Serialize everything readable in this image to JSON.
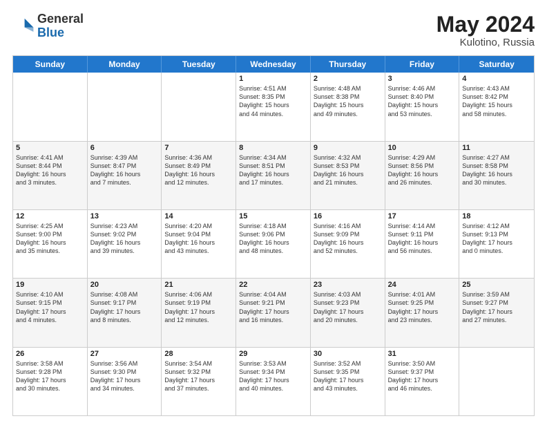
{
  "header": {
    "logo_general": "General",
    "logo_blue": "Blue",
    "month_year": "May 2024",
    "location": "Kulotino, Russia"
  },
  "days_of_week": [
    "Sunday",
    "Monday",
    "Tuesday",
    "Wednesday",
    "Thursday",
    "Friday",
    "Saturday"
  ],
  "rows": [
    {
      "alt": false,
      "cells": [
        {
          "day": "",
          "text": ""
        },
        {
          "day": "",
          "text": ""
        },
        {
          "day": "",
          "text": ""
        },
        {
          "day": "1",
          "text": "Sunrise: 4:51 AM\nSunset: 8:35 PM\nDaylight: 15 hours\nand 44 minutes."
        },
        {
          "day": "2",
          "text": "Sunrise: 4:48 AM\nSunset: 8:38 PM\nDaylight: 15 hours\nand 49 minutes."
        },
        {
          "day": "3",
          "text": "Sunrise: 4:46 AM\nSunset: 8:40 PM\nDaylight: 15 hours\nand 53 minutes."
        },
        {
          "day": "4",
          "text": "Sunrise: 4:43 AM\nSunset: 8:42 PM\nDaylight: 15 hours\nand 58 minutes."
        }
      ]
    },
    {
      "alt": true,
      "cells": [
        {
          "day": "5",
          "text": "Sunrise: 4:41 AM\nSunset: 8:44 PM\nDaylight: 16 hours\nand 3 minutes."
        },
        {
          "day": "6",
          "text": "Sunrise: 4:39 AM\nSunset: 8:47 PM\nDaylight: 16 hours\nand 7 minutes."
        },
        {
          "day": "7",
          "text": "Sunrise: 4:36 AM\nSunset: 8:49 PM\nDaylight: 16 hours\nand 12 minutes."
        },
        {
          "day": "8",
          "text": "Sunrise: 4:34 AM\nSunset: 8:51 PM\nDaylight: 16 hours\nand 17 minutes."
        },
        {
          "day": "9",
          "text": "Sunrise: 4:32 AM\nSunset: 8:53 PM\nDaylight: 16 hours\nand 21 minutes."
        },
        {
          "day": "10",
          "text": "Sunrise: 4:29 AM\nSunset: 8:56 PM\nDaylight: 16 hours\nand 26 minutes."
        },
        {
          "day": "11",
          "text": "Sunrise: 4:27 AM\nSunset: 8:58 PM\nDaylight: 16 hours\nand 30 minutes."
        }
      ]
    },
    {
      "alt": false,
      "cells": [
        {
          "day": "12",
          "text": "Sunrise: 4:25 AM\nSunset: 9:00 PM\nDaylight: 16 hours\nand 35 minutes."
        },
        {
          "day": "13",
          "text": "Sunrise: 4:23 AM\nSunset: 9:02 PM\nDaylight: 16 hours\nand 39 minutes."
        },
        {
          "day": "14",
          "text": "Sunrise: 4:20 AM\nSunset: 9:04 PM\nDaylight: 16 hours\nand 43 minutes."
        },
        {
          "day": "15",
          "text": "Sunrise: 4:18 AM\nSunset: 9:06 PM\nDaylight: 16 hours\nand 48 minutes."
        },
        {
          "day": "16",
          "text": "Sunrise: 4:16 AM\nSunset: 9:09 PM\nDaylight: 16 hours\nand 52 minutes."
        },
        {
          "day": "17",
          "text": "Sunrise: 4:14 AM\nSunset: 9:11 PM\nDaylight: 16 hours\nand 56 minutes."
        },
        {
          "day": "18",
          "text": "Sunrise: 4:12 AM\nSunset: 9:13 PM\nDaylight: 17 hours\nand 0 minutes."
        }
      ]
    },
    {
      "alt": true,
      "cells": [
        {
          "day": "19",
          "text": "Sunrise: 4:10 AM\nSunset: 9:15 PM\nDaylight: 17 hours\nand 4 minutes."
        },
        {
          "day": "20",
          "text": "Sunrise: 4:08 AM\nSunset: 9:17 PM\nDaylight: 17 hours\nand 8 minutes."
        },
        {
          "day": "21",
          "text": "Sunrise: 4:06 AM\nSunset: 9:19 PM\nDaylight: 17 hours\nand 12 minutes."
        },
        {
          "day": "22",
          "text": "Sunrise: 4:04 AM\nSunset: 9:21 PM\nDaylight: 17 hours\nand 16 minutes."
        },
        {
          "day": "23",
          "text": "Sunrise: 4:03 AM\nSunset: 9:23 PM\nDaylight: 17 hours\nand 20 minutes."
        },
        {
          "day": "24",
          "text": "Sunrise: 4:01 AM\nSunset: 9:25 PM\nDaylight: 17 hours\nand 23 minutes."
        },
        {
          "day": "25",
          "text": "Sunrise: 3:59 AM\nSunset: 9:27 PM\nDaylight: 17 hours\nand 27 minutes."
        }
      ]
    },
    {
      "alt": false,
      "cells": [
        {
          "day": "26",
          "text": "Sunrise: 3:58 AM\nSunset: 9:28 PM\nDaylight: 17 hours\nand 30 minutes."
        },
        {
          "day": "27",
          "text": "Sunrise: 3:56 AM\nSunset: 9:30 PM\nDaylight: 17 hours\nand 34 minutes."
        },
        {
          "day": "28",
          "text": "Sunrise: 3:54 AM\nSunset: 9:32 PM\nDaylight: 17 hours\nand 37 minutes."
        },
        {
          "day": "29",
          "text": "Sunrise: 3:53 AM\nSunset: 9:34 PM\nDaylight: 17 hours\nand 40 minutes."
        },
        {
          "day": "30",
          "text": "Sunrise: 3:52 AM\nSunset: 9:35 PM\nDaylight: 17 hours\nand 43 minutes."
        },
        {
          "day": "31",
          "text": "Sunrise: 3:50 AM\nSunset: 9:37 PM\nDaylight: 17 hours\nand 46 minutes."
        },
        {
          "day": "",
          "text": ""
        }
      ]
    }
  ]
}
